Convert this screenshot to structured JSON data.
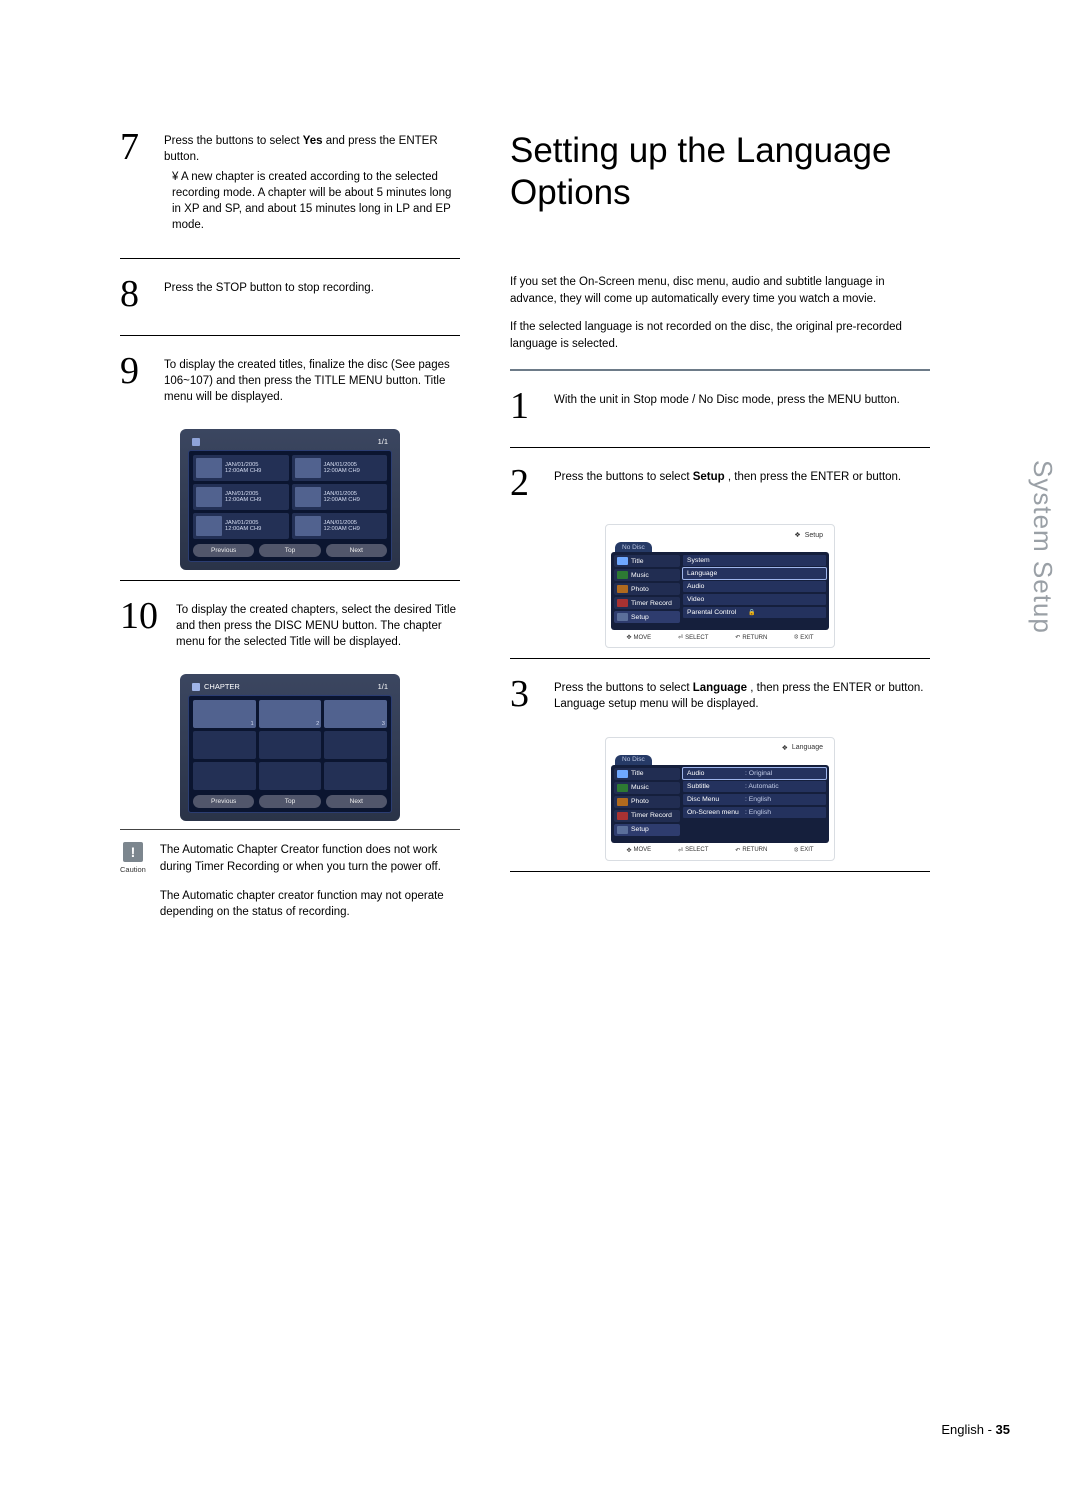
{
  "side_label": "System Setup",
  "left": {
    "step7": {
      "num": "7",
      "line1_a": "Press the ",
      "line1_b": " buttons to select ",
      "line1_yes": "Yes",
      "line1_c": " and press the ENTER button.",
      "bullet_prefix": "¥ ",
      "bullet": "A new chapter is created according to the selected recording mode. A chapter will be about 5 minutes long in XP and SP, and about 15 minutes long in LP and EP mode."
    },
    "step8": {
      "num": "8",
      "text": "Press the STOP button to stop recording."
    },
    "step9": {
      "num": "9",
      "text": "To display the created titles, finalize the disc (See pages 106~107) and then press the TITLE MENU button. Title menu will be displayed."
    },
    "title_osd": {
      "page": "1/1",
      "cells": [
        {
          "date": "JAN/01/2005",
          "time": "12:00AM CH9"
        },
        {
          "date": "JAN/01/2005",
          "time": "12:00AM CH9"
        },
        {
          "date": "JAN/01/2005",
          "time": "12:00AM CH9"
        },
        {
          "date": "JAN/01/2005",
          "time": "12:00AM CH9"
        },
        {
          "date": "JAN/01/2005",
          "time": "12:00AM CH9"
        },
        {
          "date": "JAN/01/2005",
          "time": "12:00AM CH9"
        }
      ],
      "btn_prev": "Previous",
      "btn_top": "Top",
      "btn_next": "Next"
    },
    "step10": {
      "num": "10",
      "text": "To display the created chapters, select the desired Title and then press the DISC MENU button. The chapter menu for the selected Title will be displayed."
    },
    "chapter_osd": {
      "label": "CHAPTER",
      "page": "1/1",
      "idx1": "1",
      "idx2": "2",
      "idx3": "3",
      "btn_prev": "Previous",
      "btn_top": "Top",
      "btn_next": "Next"
    },
    "caution": {
      "label": "Caution",
      "p1": "The Automatic Chapter Creator function does not work during Timer Recording or when you turn the power off.",
      "p2": "The Automatic chapter creator function may not operate depending on the status of recording."
    }
  },
  "right": {
    "title": "Setting up the Language Options",
    "intro1": "If you set the On-Screen menu, disc menu, audio and subtitle language in advance, they will come up automatically every time you watch a movie.",
    "intro2": "If the selected language is not recorded on the disc, the original pre-recorded language is selected.",
    "step1": {
      "num": "1",
      "text": "With the unit in Stop mode / No Disc mode, press the MENU button."
    },
    "step2": {
      "num": "2",
      "a": "Press the ",
      "b": " buttons to select ",
      "setup": "Setup",
      "c": ", then press the ENTER or ",
      "d": " button."
    },
    "osd_setup": {
      "header_arrow": "❖",
      "header": "Setup",
      "tab": "No Disc",
      "side": [
        "Title",
        "Music",
        "Photo",
        "Timer Record",
        "Setup"
      ],
      "items": [
        "System",
        "Language",
        "Audio",
        "Video",
        "Parental Control"
      ],
      "lock": "🔒",
      "foot": {
        "move": "MOVE",
        "select": "SELECT",
        "return": "RETURN",
        "exit": "EXIT"
      }
    },
    "step3": {
      "num": "3",
      "a": "Press the ",
      "b": " buttons to select ",
      "lang": "Language",
      "c": ", then press the ENTER or ",
      "d": " button.",
      "e": "Language setup menu will be displayed."
    },
    "osd_lang": {
      "header_arrow": "❖",
      "header": "Language",
      "tab": "No Disc",
      "side": [
        "Title",
        "Music",
        "Photo",
        "Timer Record",
        "Setup"
      ],
      "rows": [
        {
          "k": "Audio",
          "v": ": Original"
        },
        {
          "k": "Subtitle",
          "v": ": Automatic"
        },
        {
          "k": "Disc Menu",
          "v": ": English"
        },
        {
          "k": "On-Screen menu",
          "v": ": English"
        }
      ],
      "foot": {
        "move": "MOVE",
        "select": "SELECT",
        "return": "RETURN",
        "exit": "EXIT"
      }
    }
  },
  "footer": {
    "lang": "English",
    "sep": " - ",
    "page": "35"
  }
}
